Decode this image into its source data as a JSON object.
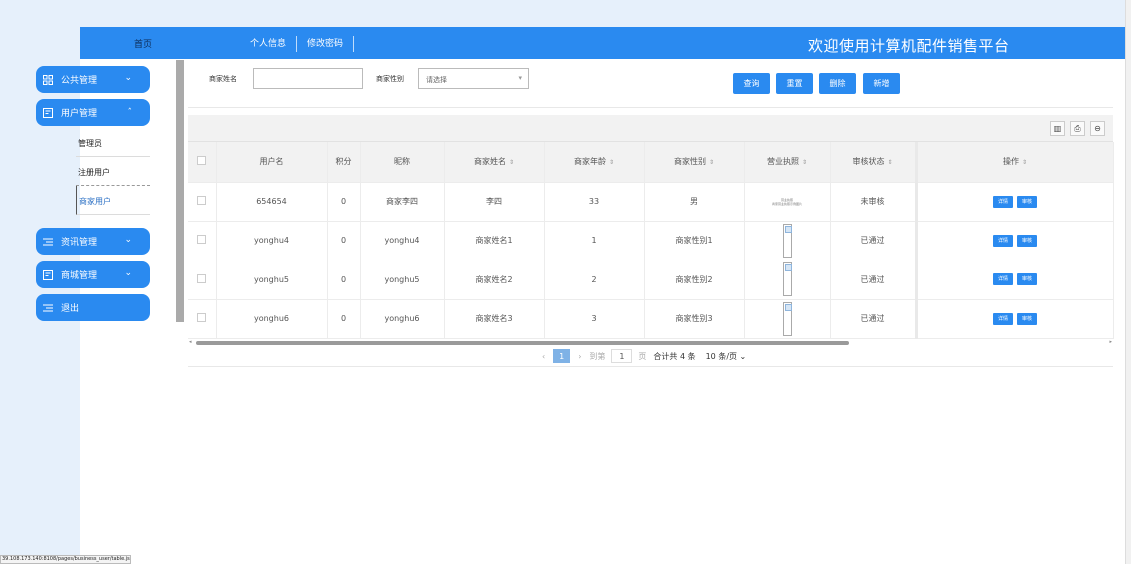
{
  "header": {
    "home": "首页",
    "nav": [
      "个人信息",
      "修改密码"
    ],
    "title": "欢迎使用计算机配件销售平台"
  },
  "sidebar": {
    "menus": [
      {
        "label": "公共管理",
        "icon": "grid-icon",
        "chevron": "down"
      },
      {
        "label": "用户管理",
        "icon": "doc-icon",
        "chevron": "up"
      },
      {
        "label": "资讯管理",
        "icon": "list-icon",
        "chevron": "down"
      },
      {
        "label": "商城管理",
        "icon": "doc-icon",
        "chevron": "down"
      },
      {
        "label": "退出",
        "icon": "list-icon"
      }
    ],
    "sub_items": [
      "管理员",
      "注册用户",
      "商家用户"
    ],
    "active_sub": "商家用户"
  },
  "search": {
    "name_label": "商家姓名",
    "name_value": "",
    "gender_label": "商家性别",
    "gender_placeholder": "请选择",
    "buttons": [
      "查询",
      "重置",
      "删除",
      "新增"
    ]
  },
  "toolbar_icons": [
    "columns-icon",
    "export-icon",
    "print-icon"
  ],
  "table": {
    "columns": [
      "用户名",
      "积分",
      "昵称",
      "商家姓名",
      "商家年龄",
      "商家性别",
      "营业执照",
      "审核状态",
      "操作"
    ],
    "rows": [
      {
        "username": "654654",
        "points": "0",
        "nickname": "商家李四",
        "name": "李四",
        "age": "33",
        "gender": "男",
        "license_text_1": "营业执照",
        "license_text_2": "商家营业执照示例图片",
        "status": "未审核"
      },
      {
        "username": "yonghu4",
        "points": "0",
        "nickname": "yonghu4",
        "name": "商家姓名1",
        "age": "1",
        "gender": "商家性别1",
        "status": "已通过"
      },
      {
        "username": "yonghu5",
        "points": "0",
        "nickname": "yonghu5",
        "name": "商家姓名2",
        "age": "2",
        "gender": "商家性别2",
        "status": "已通过"
      },
      {
        "username": "yonghu6",
        "points": "0",
        "nickname": "yonghu6",
        "name": "商家姓名3",
        "age": "3",
        "gender": "商家性别3",
        "status": "已通过"
      }
    ],
    "action_detail": "详情",
    "action_review": "审核"
  },
  "pagination": {
    "current_page": "1",
    "goto_label": "到第",
    "goto_value": "1",
    "page_unit": "页",
    "total": "合计共 4 条",
    "page_size": "10 条/页"
  },
  "status_url": "39.108.173.140:8108/pages/business_user/table.jsp",
  "colors": {
    "accent": "#2a8af0",
    "background": "#e6f0fb"
  }
}
